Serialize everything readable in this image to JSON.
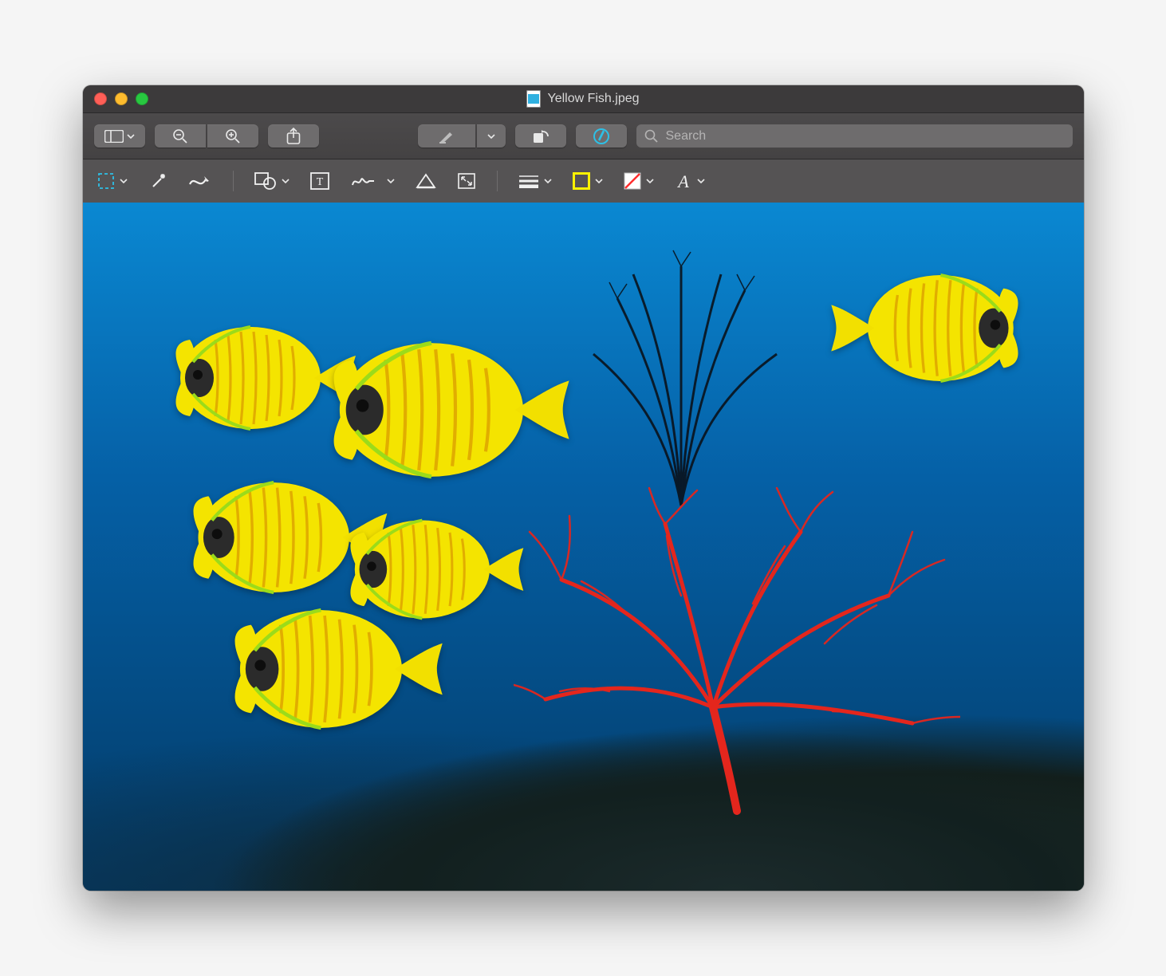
{
  "window": {
    "title": "Yellow Fish.jpeg"
  },
  "toolbar": {
    "sidebar_button": "Sidebar",
    "zoom_out": "Zoom Out",
    "zoom_in": "Zoom In",
    "share": "Share",
    "highlight": "Highlight",
    "rotate": "Rotate",
    "markup": "Markup",
    "search_placeholder": "Search"
  },
  "markup_toolbar": {
    "selection": "Rectangular Selection",
    "instant_alpha": "Instant Alpha",
    "sketch": "Sketch",
    "shapes": "Shapes",
    "text": "Text",
    "sign": "Sign",
    "adjust_color": "Adjust Color",
    "adjust_size": "Adjust Size",
    "border_style": "Shape Style",
    "border_color": "Border Color",
    "fill_color": "Fill Color",
    "text_style": "Text Style"
  },
  "colors": {
    "border_swatch": "#fff200",
    "fill_swatch_slash": "#ff2d2d"
  }
}
